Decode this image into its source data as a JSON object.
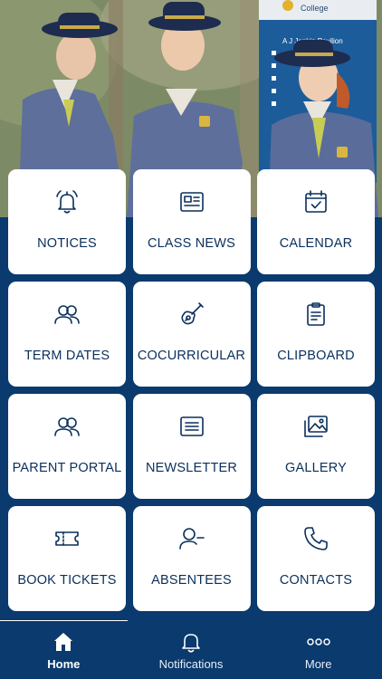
{
  "tiles": [
    {
      "label": "NOTICES",
      "icon": "bell-icon"
    },
    {
      "label": "CLASS NEWS",
      "icon": "newspaper-icon"
    },
    {
      "label": "CALENDAR",
      "icon": "calendar-icon"
    },
    {
      "label": "TERM DATES",
      "icon": "people-icon"
    },
    {
      "label": "COCURRICULAR",
      "icon": "guitar-icon"
    },
    {
      "label": "CLIPBOARD",
      "icon": "clipboard-icon"
    },
    {
      "label": "PARENT PORTAL",
      "icon": "people-icon"
    },
    {
      "label": "NEWSLETTER",
      "icon": "newsletter-icon"
    },
    {
      "label": "GALLERY",
      "icon": "gallery-icon"
    },
    {
      "label": "BOOK TICKETS",
      "icon": "ticket-icon"
    },
    {
      "label": "ABSENTEES",
      "icon": "user-minus-icon"
    },
    {
      "label": "CONTACTS",
      "icon": "phone-icon"
    }
  ],
  "tabbar": {
    "home": "Home",
    "notifications": "Notifications",
    "more": "More"
  },
  "hero": {
    "sign_lines": [
      "College",
      "A J Jenkin Pavilion"
    ]
  },
  "colors": {
    "primary": "#0a3a6e",
    "tile_background": "#ffffff",
    "tile_text": "#0a2f5c"
  }
}
